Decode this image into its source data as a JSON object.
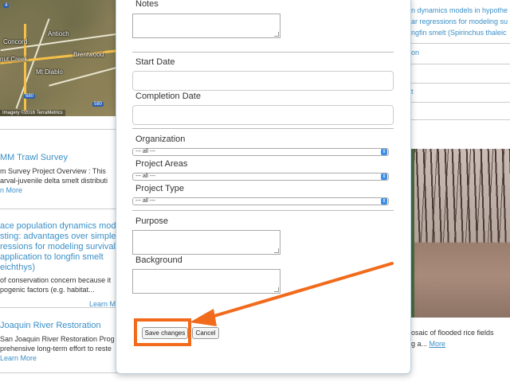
{
  "map": {
    "labels": [
      "Concord",
      "Antioch",
      "Brentwood",
      "nut Creek",
      "Mt Diablo"
    ],
    "shields": [
      "680",
      "580",
      "4"
    ],
    "credit": "Imagery ©2016 TerraMetrics"
  },
  "left_items": [
    {
      "title": "MM Trawl Survey",
      "body": "m Survey Project Overview : This\narval-juvenile delta smelt distributi",
      "link": "n More"
    },
    {
      "title": "ace population dynamics mode\nsting: advantages over simple\nressions for modeling survival,\napplication to longfin smelt\neichthys)",
      "body": "of conservation concern because it\npogenic factors (e.g. habitat...",
      "link": "Learn M"
    },
    {
      "title": "Joaquin River Restoration",
      "body": "San Joaquin River Restoration Prog\nprehensive long-term effort to reste",
      "link": "Learn More"
    }
  ],
  "right_col": {
    "lines": [
      "n dynamics models in hypothe",
      "ar regressions for modeling su",
      "ngfin smelt (Spirinchus thaleic"
    ],
    "row_a": "on",
    "row_b": "t",
    "caption": "osaic of flooded rice fields",
    "caption2": "g a...",
    "more": "More"
  },
  "modal": {
    "notes_label": "Notes",
    "start_date_label": "Start Date",
    "start_date_value": "",
    "completion_date_label": "Completion Date",
    "completion_date_value": "",
    "organization_label": "Organization",
    "organization_value": "--- all ---",
    "project_areas_label": "Project Areas",
    "project_areas_value": "--- all ---",
    "project_type_label": "Project Type",
    "project_type_value": "--- all ---",
    "purpose_label": "Purpose",
    "background_label": "Background",
    "save_label": "Save changes",
    "cancel_label": "Cancel"
  },
  "annotation": {
    "color": "#f26a1b"
  }
}
